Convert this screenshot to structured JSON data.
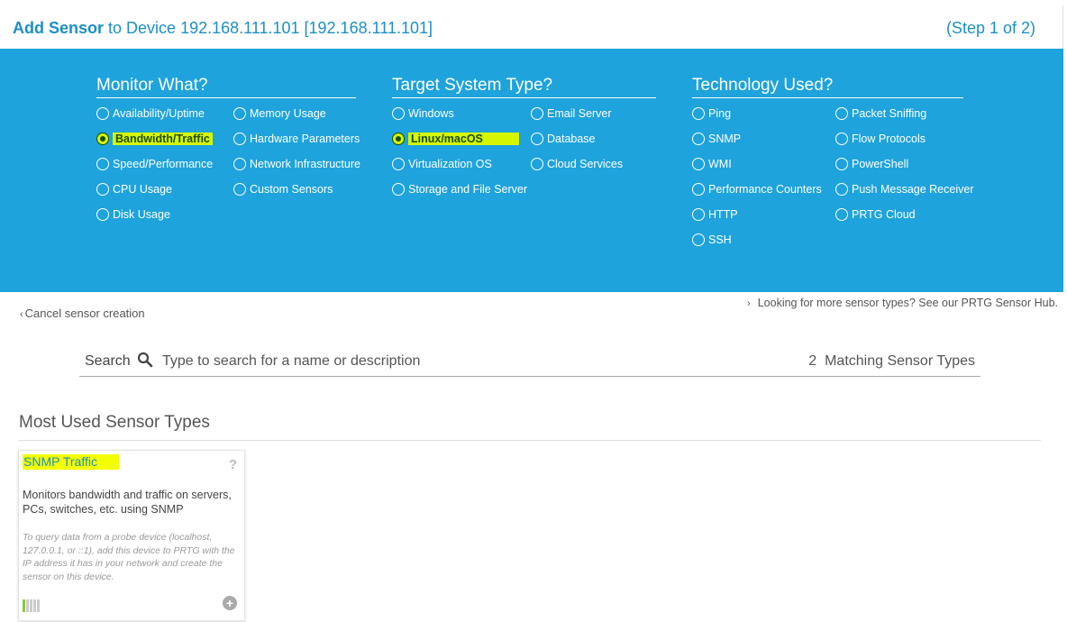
{
  "header": {
    "title_strong": "Add Sensor",
    "title_rest": "to Device 192.168.111.101 [192.168.111.101]",
    "step": "(Step 1 of 2)"
  },
  "filters": {
    "monitor": {
      "title": "Monitor What?",
      "options": [
        {
          "label": "Availability/Uptime",
          "checked": false
        },
        {
          "label": "Bandwidth/Traffic",
          "checked": true
        },
        {
          "label": "Speed/Performance",
          "checked": false
        },
        {
          "label": "CPU Usage",
          "checked": false
        },
        {
          "label": "Disk Usage",
          "checked": false
        },
        {
          "label": "Memory Usage",
          "checked": false
        },
        {
          "label": "Hardware Parameters",
          "checked": false
        },
        {
          "label": "Network Infrastructure",
          "checked": false
        },
        {
          "label": "Custom Sensors",
          "checked": false
        }
      ]
    },
    "target": {
      "title": "Target System Type?",
      "options": [
        {
          "label": "Windows",
          "checked": false
        },
        {
          "label": "Linux/macOS",
          "checked": true
        },
        {
          "label": "Virtualization OS",
          "checked": false
        },
        {
          "label": "Storage and File Server",
          "checked": false
        },
        {
          "label": "Email Server",
          "checked": false
        },
        {
          "label": "Database",
          "checked": false
        },
        {
          "label": "Cloud Services",
          "checked": false
        }
      ]
    },
    "technology": {
      "title": "Technology Used?",
      "options": [
        {
          "label": "Ping",
          "checked": false
        },
        {
          "label": "SNMP",
          "checked": false
        },
        {
          "label": "WMI",
          "checked": false
        },
        {
          "label": "Performance Counters",
          "checked": false
        },
        {
          "label": "HTTP",
          "checked": false
        },
        {
          "label": "SSH",
          "checked": false
        },
        {
          "label": "Packet Sniffing",
          "checked": false
        },
        {
          "label": "Flow Protocols",
          "checked": false
        },
        {
          "label": "PowerShell",
          "checked": false
        },
        {
          "label": "Push Message Receiver",
          "checked": false
        },
        {
          "label": "PRTG Cloud",
          "checked": false
        }
      ]
    }
  },
  "links": {
    "cancel": "Cancel sensor creation",
    "hub": "Looking for more sensor types? See our PRTG Sensor Hub."
  },
  "search": {
    "label": "Search",
    "placeholder": "Type to search for a name or description",
    "match_count": "2",
    "match_label": "Matching Sensor Types"
  },
  "section": {
    "title": "Most Used Sensor Types"
  },
  "card": {
    "title": "SNMP Traffic",
    "help": "?",
    "description": "Monitors bandwidth and traffic on servers, PCs, switches, etc. using SNMP",
    "note": "To query data from a probe device (localhost, 127.0.0.1, or ::1), add this device to PRTG with the IP address it has in your network and create the sensor on this device.",
    "performance_impact_level": 1,
    "performance_impact_max": 5
  },
  "colors": {
    "accent": "#1c8fc6",
    "panel": "#1ea3dc",
    "highlight": "#d4f700",
    "impact_on": "#8cc63f"
  }
}
